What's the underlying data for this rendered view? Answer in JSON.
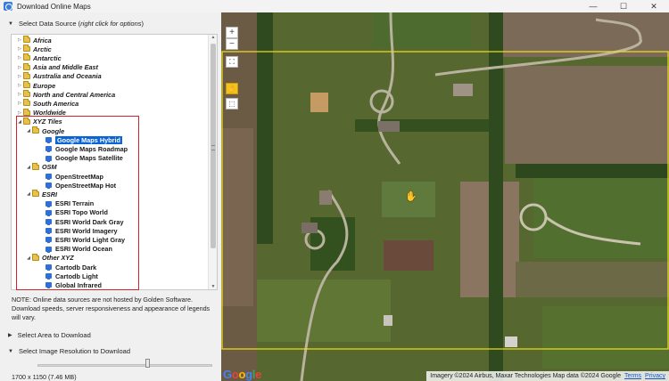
{
  "window": {
    "title": "Download Online Maps",
    "controls": {
      "minimize": "—",
      "maximize": "☐",
      "close": "✕"
    }
  },
  "left_panel": {
    "select_source": {
      "prefix": "Select Data Source (",
      "hint": "right click for options",
      "suffix": ")"
    },
    "tree": {
      "top_folders": [
        "Africa",
        "Arctic",
        "Antarctic",
        "Asia and Middle East",
        "Australia and Oceania",
        "Europe",
        "North and Central America",
        "South America",
        "Worldwide"
      ],
      "xyz": {
        "label": "XYZ Tiles",
        "google": {
          "label": "Google",
          "items": [
            "Google Maps Hybrid",
            "Google Maps Roadmap",
            "Google Maps Satellite"
          ]
        },
        "osm": {
          "label": "OSM",
          "items": [
            "OpenStreetMap",
            "OpenStreetMap Hot"
          ]
        },
        "esri": {
          "label": "ESRI",
          "items": [
            "ESRI Terrain",
            "ESRI Topo World",
            "ESRI World Dark Gray",
            "ESRI World Imagery",
            "ESRI World Light Gray",
            "ESRI World Ocean"
          ]
        },
        "other": {
          "label": "Other XYZ",
          "items": [
            "Cartodb Dark",
            "Cartodb Light",
            "Global Infrared"
          ]
        }
      },
      "selected_item": "Google Maps Hybrid"
    },
    "note": "NOTE: Online data sources are not hosted by Golden Software. Download speeds, server responsiveness and appearance of legends will vary.",
    "select_area": "Select Area to Download",
    "select_resolution": "Select Image Resolution to Download",
    "resolution_value": "1700 x 1150  (7.46 MB)",
    "resolution_slider_fraction": 0.63
  },
  "map": {
    "controls": {
      "zoom_in": "+",
      "zoom_out": "−",
      "fit": "⛶",
      "select": "⬚"
    },
    "attribution": "Imagery ©2024 Airbus, Maxar Technologies Map data ©2024 Google",
    "terms_label": "Terms",
    "privacy_label": "Privacy",
    "logo_letters": [
      "G",
      "o",
      "o",
      "g",
      "l",
      "e"
    ],
    "selection_color": "#f1e21b"
  }
}
